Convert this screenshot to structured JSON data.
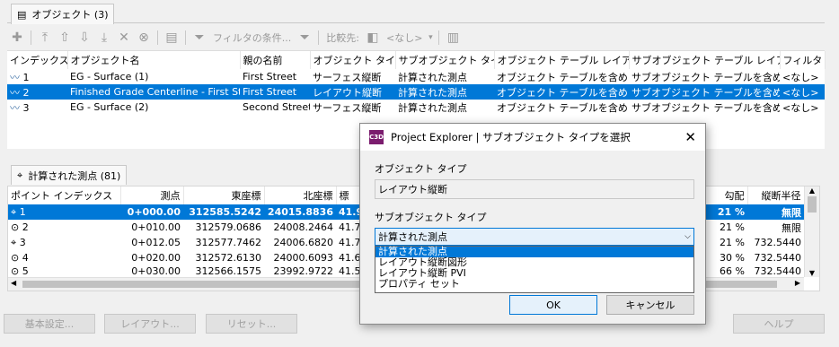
{
  "objects_tab": {
    "label": "オブジェクト (3)"
  },
  "toolbar": {
    "filter_label": "フィルタの条件...",
    "compare_label": "比較先:",
    "compare_value": "<なし>"
  },
  "objects_grid": {
    "headers": [
      "インデックス",
      "オブジェクト名",
      "親の名前",
      "オブジェクト タイプ",
      "サブオブジェクト タイプ",
      "オブジェクト テーブル レイアウト",
      "サブオブジェクト テーブル レイアウト",
      "フィルタ"
    ],
    "rows": [
      {
        "index": "1",
        "name": "EG - Surface (1)",
        "parent": "First Street",
        "type": "サーフェス縦断",
        "subtype": "計算された測点",
        "layout": "オブジェクト テーブルを含める",
        "sublayout": "サブオブジェクト テーブルを含める",
        "filter": "<なし>"
      },
      {
        "index": "2",
        "name": "Finished Grade Centerline - First Street",
        "parent": "First Street",
        "type": "レイアウト縦断",
        "subtype": "計算された測点",
        "layout": "オブジェクト テーブルを含める",
        "sublayout": "サブオブジェクト テーブルを含める",
        "filter": "<なし>"
      },
      {
        "index": "3",
        "name": "EG - Surface (2)",
        "parent": "Second Street",
        "type": "サーフェス縦断",
        "subtype": "計算された測点",
        "layout": "オブジェクト テーブルを含める",
        "sublayout": "サブオブジェクト テーブルを含める",
        "filter": "<なし>"
      }
    ]
  },
  "points_tab": {
    "label": "計算された測点 (81)"
  },
  "points_grid": {
    "headers": [
      "ポイント インデックス",
      "測点",
      "東座標",
      "北座標",
      "標",
      "勾配",
      "縦断半径"
    ],
    "rows": [
      {
        "index": "1",
        "station": "0+000.00",
        "east": "312585.5242",
        "north": "24015.8836",
        "elev": "41.9",
        "grade": "21 %",
        "radius": "無限"
      },
      {
        "index": "2",
        "station": "0+010.00",
        "east": "312579.0686",
        "north": "24008.2464",
        "elev": "41.7",
        "grade": "21 %",
        "radius": "無限"
      },
      {
        "index": "3",
        "station": "0+012.05",
        "east": "312577.7462",
        "north": "24006.6820",
        "elev": "41.7",
        "grade": "21 %",
        "radius": "732.5440"
      },
      {
        "index": "4",
        "station": "0+020.00",
        "east": "312572.6130",
        "north": "24000.6093",
        "elev": "41.6",
        "grade": "30 %",
        "radius": "732.5440"
      },
      {
        "index": "5",
        "station": "0+030.00",
        "east": "312566.1575",
        "north": "23992.9722",
        "elev": "41.5",
        "grade": "66 %",
        "radius": "732.5440"
      }
    ]
  },
  "bottom_buttons": {
    "basic": "基本設定...",
    "layout": "レイアウト...",
    "reset": "リセット...",
    "help": "ヘルプ"
  },
  "dialog": {
    "title": "Project Explorer | サブオブジェクト タイプを選択",
    "app_icon_text": "C3D",
    "object_type_label": "オブジェクト タイプ",
    "object_type_value": "レイアウト縦断",
    "subobject_type_label": "サブオブジェクト タイプ",
    "selected": "計算された測点",
    "options": [
      "計算された測点",
      "レイアウト縦断図形",
      "レイアウト縦断 PVI",
      "プロパティ セット"
    ],
    "ok": "OK",
    "cancel": "キャンセル"
  }
}
